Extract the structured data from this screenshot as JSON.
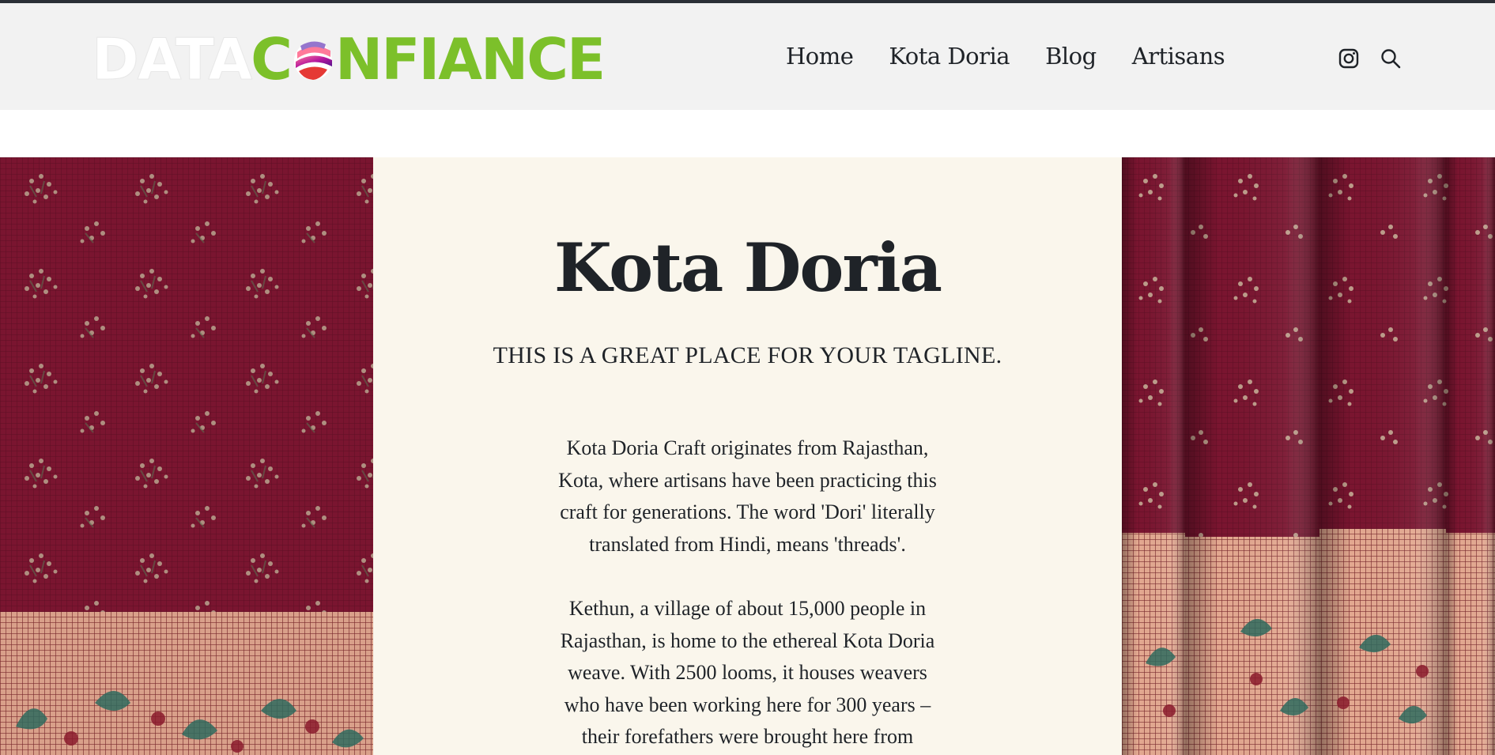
{
  "header": {
    "logo": {
      "part1": "DATA",
      "part2_before": "C",
      "part2_after": "NFIANCE"
    },
    "nav": [
      "Home",
      "Kota Doria",
      "Blog",
      "Artisans"
    ],
    "icons": [
      "instagram-icon",
      "search-icon"
    ]
  },
  "hero": {
    "title": "Kota Doria",
    "tagline": "THIS IS A GREAT PLACE FOR YOUR TAGLINE.",
    "paragraphs": [
      "Kota Doria Craft originates from Rajasthan, Kota, where artisans have been practicing this craft for generations. The word 'Dori' literally translated from Hindi, means 'threads'.",
      "Kethun, a village of about 15,000 people in Rajasthan, is home to the ethereal Kota Doria weave. With 2500 looms, it houses weavers who have been working here for 300 years – their forefathers were brought here from"
    ]
  },
  "colors": {
    "header_bg": "#f2f2f2",
    "logo_green": "#7cc02a",
    "panel_bg": "#faf6ec",
    "fabric_maroon": "#7a1530",
    "fabric_border": "#d9a08a",
    "text": "#1f2328"
  }
}
